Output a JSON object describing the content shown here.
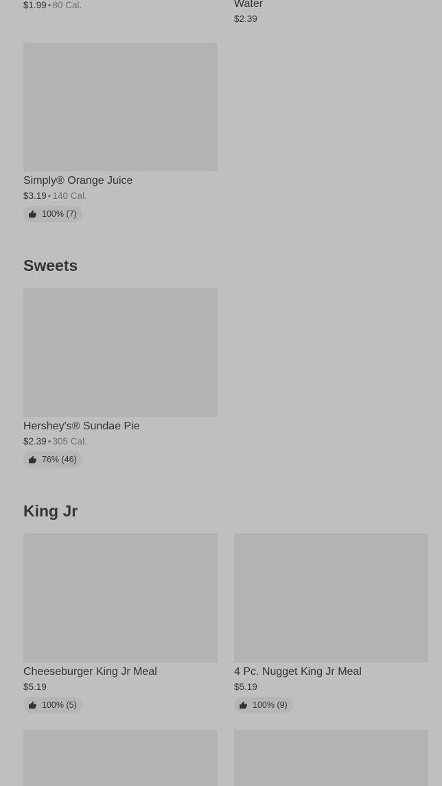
{
  "colors": {
    "background": "#bfbfbf",
    "image_placeholder": "#b3b3b3",
    "rating_pill": "#b6b6b6",
    "text": "#333333",
    "muted": "#6f6f6f"
  },
  "separator": "•",
  "items_top": [
    {
      "price": "$1.99",
      "calories": "80 Cal."
    },
    {
      "name": "Water",
      "price": "$2.39"
    }
  ],
  "drinks": [
    {
      "name": "Simply® Orange Juice",
      "price": "$3.19",
      "calories": "140 Cal.",
      "rating": "100% (7)",
      "rating_icon": "thumbs-up-icon"
    }
  ],
  "sections": {
    "sweets": {
      "title": "Sweets"
    },
    "king_jr": {
      "title": "King Jr"
    }
  },
  "sweets_items": [
    {
      "name": "Hershey's® Sundae Pie",
      "price": "$2.39",
      "calories": "305 Cal.",
      "rating": "76% (46)",
      "rating_icon": "thumbs-up-icon"
    }
  ],
  "king_jr_items": [
    {
      "name": "Cheeseburger King Jr Meal",
      "price": "$5.19",
      "rating": "100% (5)",
      "rating_icon": "thumbs-up-icon"
    },
    {
      "name": "4 Pc. Nugget King Jr Meal",
      "price": "$5.19",
      "rating": "100% (9)",
      "rating_icon": "thumbs-up-icon"
    }
  ]
}
